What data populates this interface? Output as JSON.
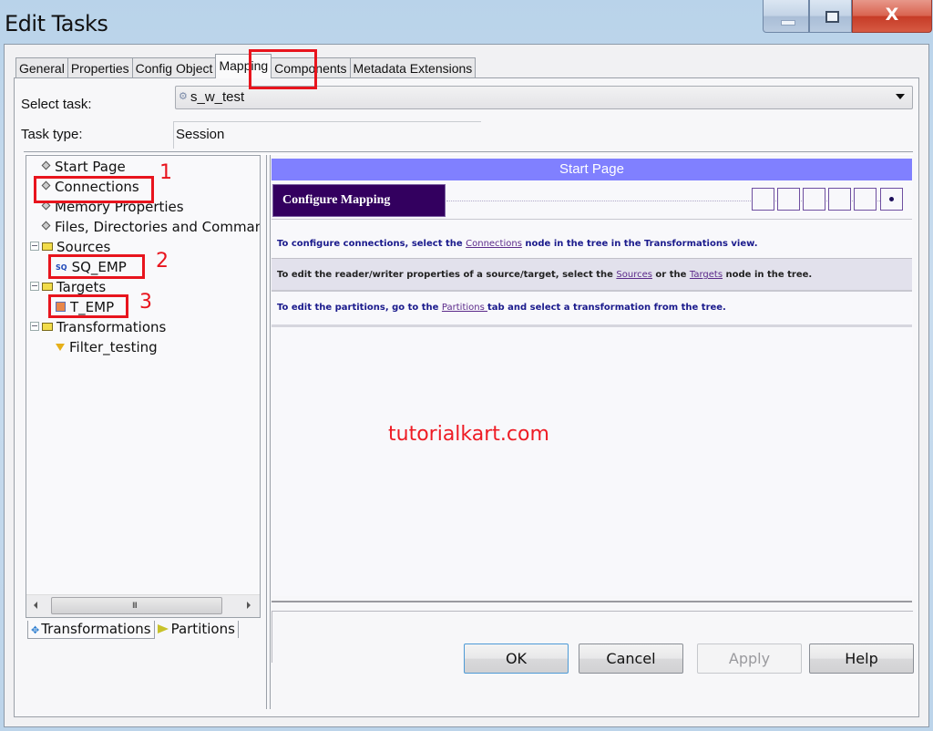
{
  "window": {
    "title": "Edit Tasks",
    "controls": {
      "minimize": "minimize",
      "maximize": "maximize",
      "close": "X"
    }
  },
  "tabs": [
    {
      "label": "General",
      "active": false
    },
    {
      "label": "Properties",
      "active": false
    },
    {
      "label": "Config Object",
      "active": false
    },
    {
      "label": "Mapping",
      "active": true
    },
    {
      "label": "Components",
      "active": false
    },
    {
      "label": "Metadata Extensions",
      "active": false
    }
  ],
  "form": {
    "select_task_label": "Select task:",
    "select_task_value": "s_w_test",
    "task_type_label": "Task type:",
    "task_type_value": "Session"
  },
  "tree": {
    "items": [
      {
        "label": "Start Page",
        "icon": "diamond-icon"
      },
      {
        "label": "Connections",
        "icon": "diamond-icon"
      },
      {
        "label": "Memory Properties",
        "icon": "diamond-icon"
      },
      {
        "label": "Files, Directories and Commands",
        "icon": "diamond-icon"
      },
      {
        "label": "Sources",
        "icon": "folder-icon"
      },
      {
        "label": "SQ_EMP",
        "icon": "source-qualifier-icon"
      },
      {
        "label": "Targets",
        "icon": "folder-icon"
      },
      {
        "label": "T_EMP",
        "icon": "target-icon"
      },
      {
        "label": "Transformations",
        "icon": "folder-icon"
      },
      {
        "label": "Filter_testing",
        "icon": "filter-icon"
      }
    ],
    "annotations": [
      "1",
      "2",
      "3"
    ]
  },
  "bottom_tabs": [
    {
      "label": "Transformations",
      "active": true
    },
    {
      "label": "Partitions",
      "active": false
    }
  ],
  "start_page": {
    "header": "Start Page",
    "configure_title": "Configure Mapping",
    "rows": {
      "r1": {
        "pre": "To configure connections, select the ",
        "link": "Connections",
        "post": " node in the tree in the Transformations view."
      },
      "r2": {
        "pre": "To edit the reader/writer properties of a source/target, select the ",
        "link1": "Sources",
        "mid": " or the ",
        "link2": "Targets",
        "post": " node in the tree."
      },
      "r3": {
        "pre": "To edit the partitions, go to the ",
        "link": "Partitions ",
        "post": "tab and select a transformation from the tree."
      }
    }
  },
  "watermark": "tutorialkart.com",
  "buttons": {
    "ok": "OK",
    "cancel": "Cancel",
    "apply": "Apply",
    "help": "Help"
  },
  "colors": {
    "accent": "#8080ff",
    "configure_bg": "#33005f",
    "annotation": "#e8141d"
  }
}
